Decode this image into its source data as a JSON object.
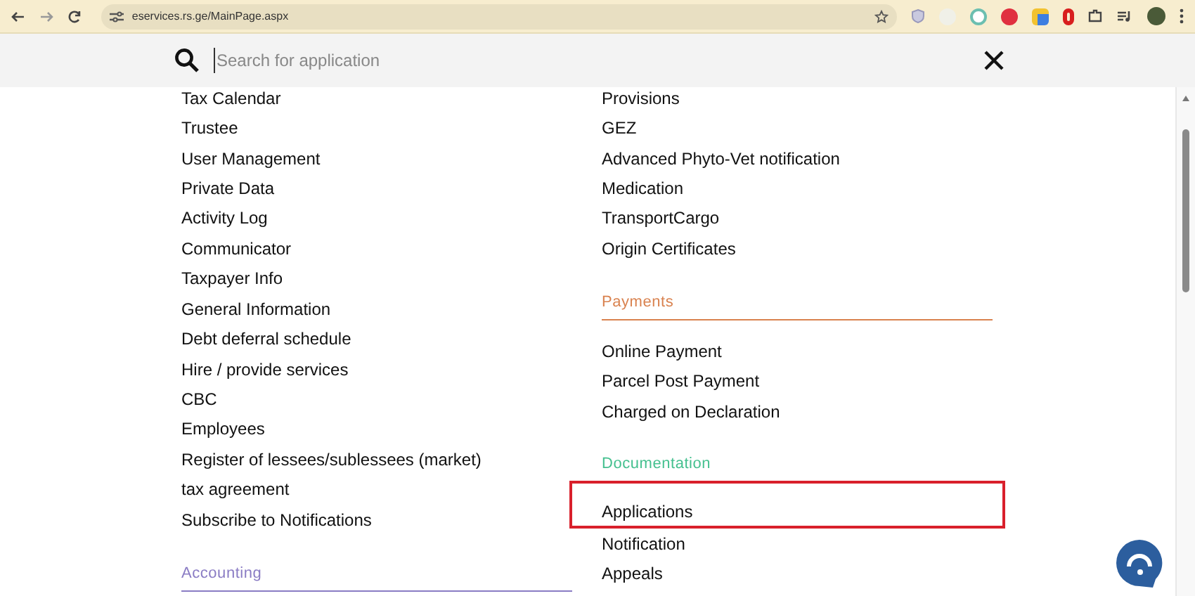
{
  "browser": {
    "url": "eservices.rs.ge/MainPage.aspx"
  },
  "search": {
    "placeholder": "Search for application"
  },
  "columns": [
    {
      "items": [
        {
          "label": "Tax Calendar",
          "highlighted": false
        },
        {
          "label": "Trustee",
          "highlighted": false
        },
        {
          "label": "User Management",
          "highlighted": false
        },
        {
          "label": "Private Data",
          "highlighted": false
        },
        {
          "label": "Activity Log",
          "highlighted": false
        },
        {
          "label": "Communicator",
          "highlighted": false
        },
        {
          "label": "Taxpayer Info",
          "highlighted": false
        },
        {
          "label": "General Information",
          "highlighted": false
        },
        {
          "label": "Debt deferral schedule",
          "highlighted": false
        },
        {
          "label": "Hire / provide services",
          "highlighted": false
        },
        {
          "label": "CBC",
          "highlighted": false
        },
        {
          "label": "Employees",
          "highlighted": false
        },
        {
          "label": "Register of lessees/sublessees (market)",
          "highlighted": false
        },
        {
          "label": "tax agreement",
          "highlighted": false
        },
        {
          "label": "Subscribe to Notifications",
          "highlighted": false
        }
      ],
      "sections": [
        {
          "title": "Accounting",
          "color": "#8a7cc4"
        }
      ]
    },
    {
      "items": [
        {
          "label": "Provisions",
          "highlighted": false
        },
        {
          "label": "GEZ",
          "highlighted": false
        },
        {
          "label": "Advanced Phyto-Vet notification",
          "highlighted": false
        },
        {
          "label": "Medication",
          "highlighted": false
        },
        {
          "label": "TransportCargo",
          "highlighted": false
        },
        {
          "label": "Origin Certificates",
          "highlighted": false
        }
      ],
      "sections": [
        {
          "title": "Payments",
          "color": "#d9824f",
          "items": [
            {
              "label": "Online Payment",
              "highlighted": false
            },
            {
              "label": "Parcel Post Payment",
              "highlighted": false
            },
            {
              "label": "Charged on Declaration",
              "highlighted": false
            }
          ]
        },
        {
          "title": "Documentation",
          "color": "#45c08f",
          "items": [
            {
              "label": "Applications",
              "highlighted": true
            },
            {
              "label": "Notification",
              "highlighted": false
            },
            {
              "label": "Appeals",
              "highlighted": false
            }
          ]
        }
      ]
    }
  ]
}
